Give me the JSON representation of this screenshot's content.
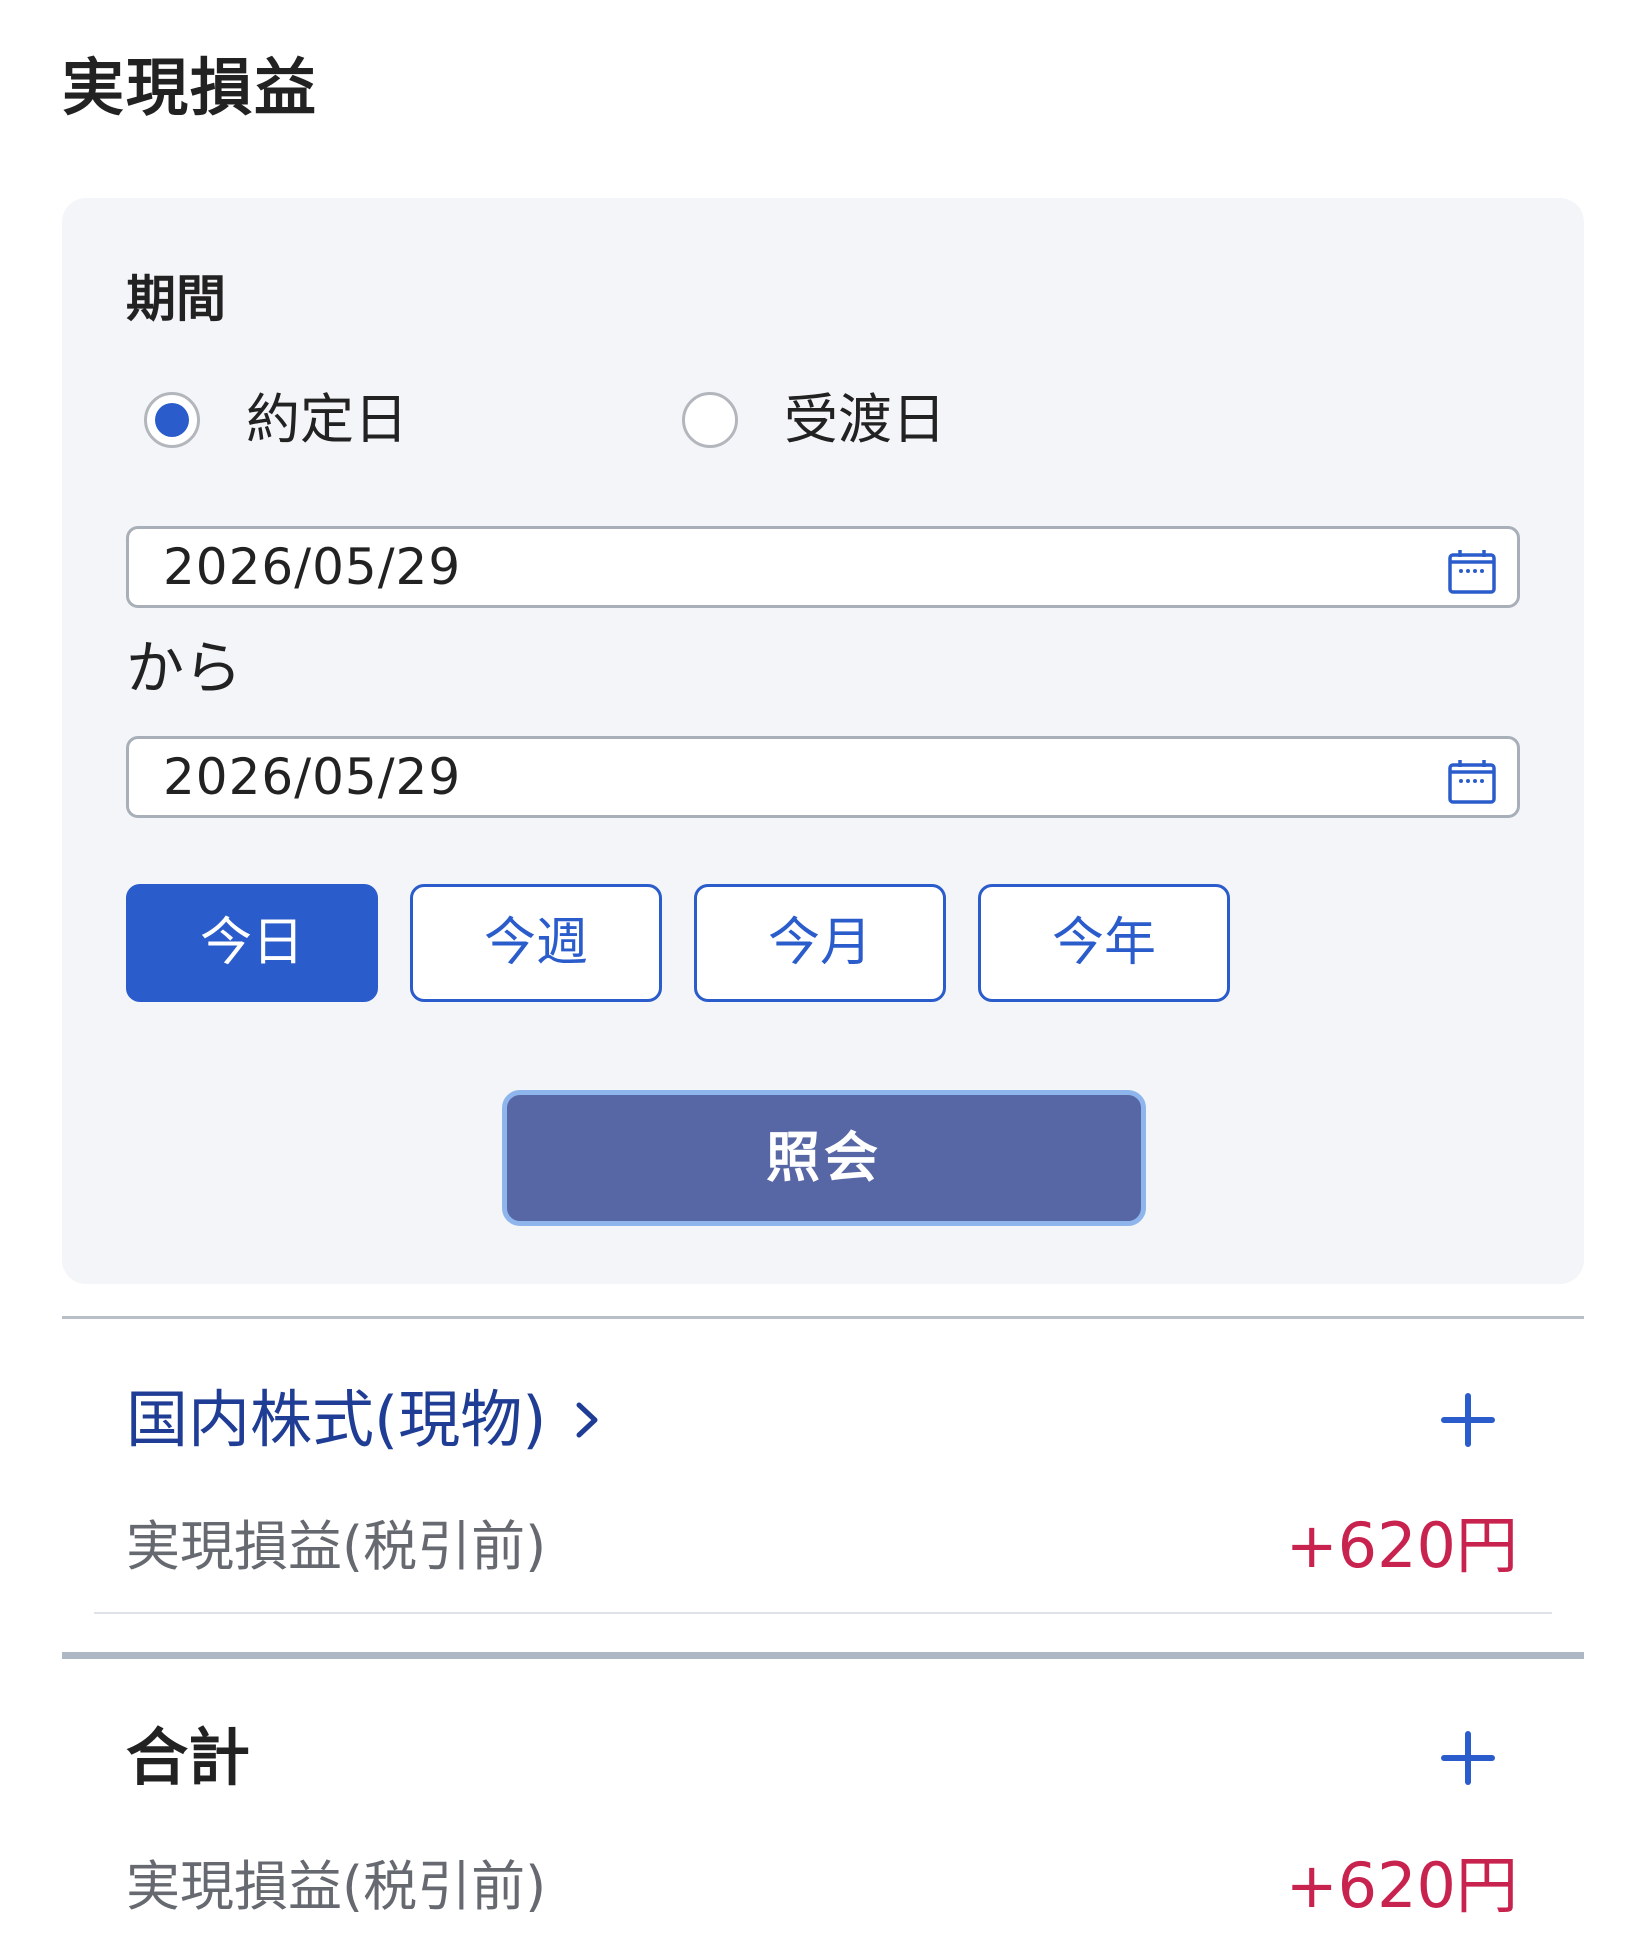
{
  "page": {
    "title": "実現損益"
  },
  "filter": {
    "period_label": "期間",
    "date_type_options": [
      {
        "label": "約定日",
        "checked": true
      },
      {
        "label": "受渡日",
        "checked": false
      }
    ],
    "start_date": "2026/05/29",
    "from_label": "から",
    "end_date": "2026/05/29",
    "quick_ranges": [
      {
        "label": "今日",
        "active": true
      },
      {
        "label": "今週",
        "active": false
      },
      {
        "label": "今月",
        "active": false
      },
      {
        "label": "今年",
        "active": false
      }
    ],
    "submit_label": "照会"
  },
  "sections": [
    {
      "title": "国内株式(現物)",
      "row_label": "実現損益(税引前)",
      "value": "+620円",
      "icon": "plus-icon"
    }
  ],
  "total": {
    "title": "合計",
    "row_label": "実現損益(税引前)",
    "value": "+620円",
    "icon": "plus-icon"
  },
  "colors": {
    "accent": "#2b5ccc",
    "link": "#1f3d95",
    "submit": "#5767a5",
    "profit": "#c8234f",
    "panel_bg": "#f3f5f8"
  }
}
